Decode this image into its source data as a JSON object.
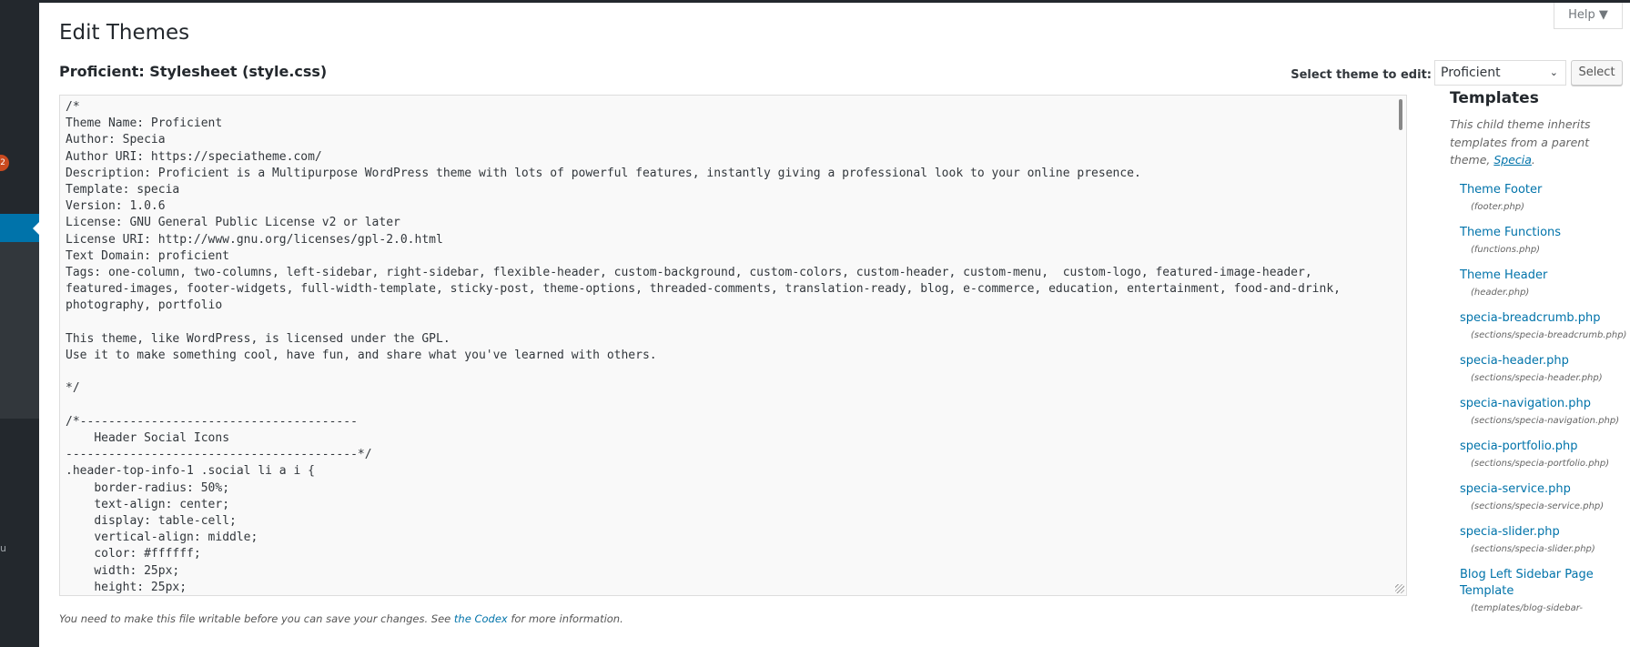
{
  "sidebar": {
    "badge": "2",
    "collapse_glyph": "u",
    "active_color": "#0073aa"
  },
  "header": {
    "title": "Edit Themes",
    "help": "Help",
    "help_icon": "caret-down-icon"
  },
  "subtitle": "Proficient: Stylesheet (style.css)",
  "theme_select": {
    "label": "Select theme to edit:",
    "value": "Proficient",
    "button": "Select"
  },
  "editor": {
    "content": "/*\nTheme Name: Proficient\nAuthor: Specia\nAuthor URI: https://speciatheme.com/\nDescription: Proficient is a Multipurpose WordPress theme with lots of powerful features, instantly giving a professional look to your online presence.\nTemplate: specia\nVersion: 1.0.6\nLicense: GNU General Public License v2 or later\nLicense URI: http://www.gnu.org/licenses/gpl-2.0.html\nText Domain: proficient\nTags: one-column, two-columns, left-sidebar, right-sidebar, flexible-header, custom-background, custom-colors, custom-header, custom-menu,  custom-logo, featured-image-header, featured-images, footer-widgets, full-width-template, sticky-post, theme-options, threaded-comments, translation-ready, blog, e-commerce, education, entertainment, food-and-drink, photography, portfolio\n\nThis theme, like WordPress, is licensed under the GPL.\nUse it to make something cool, have fun, and share what you've learned with others.\n\n*/\n\n/*---------------------------------------\n    Header Social Icons\n-----------------------------------------*/\n.header-top-info-1 .social li a i {\n    border-radius: 50%;\n    text-align: center;\n    display: table-cell;\n    vertical-align: middle;\n    color: #ffffff;\n    width: 25px;\n    height: 25px;\n"
  },
  "note": {
    "before": "You need to make this file writable before you can save your changes. See ",
    "link": "the Codex",
    "after": " for more information."
  },
  "templates": {
    "heading": "Templates",
    "desc_before": "This child theme inherits templates from a parent theme, ",
    "parent_link": "Specia",
    "desc_after": ".",
    "items": [
      {
        "name": "Theme Footer",
        "file": "(footer.php)"
      },
      {
        "name": "Theme Functions",
        "file": "(functions.php)"
      },
      {
        "name": "Theme Header",
        "file": "(header.php)"
      },
      {
        "name": "specia-breadcrumb.php",
        "file": "(sections/specia-breadcrumb.php)"
      },
      {
        "name": "specia-header.php",
        "file": "(sections/specia-header.php)"
      },
      {
        "name": "specia-navigation.php",
        "file": "(sections/specia-navigation.php)"
      },
      {
        "name": "specia-portfolio.php",
        "file": "(sections/specia-portfolio.php)"
      },
      {
        "name": "specia-service.php",
        "file": "(sections/specia-service.php)"
      },
      {
        "name": "specia-slider.php",
        "file": "(sections/specia-slider.php)"
      },
      {
        "name": "Blog Left Sidebar Page Template",
        "file": "(templates/blog-sidebar-"
      }
    ]
  }
}
